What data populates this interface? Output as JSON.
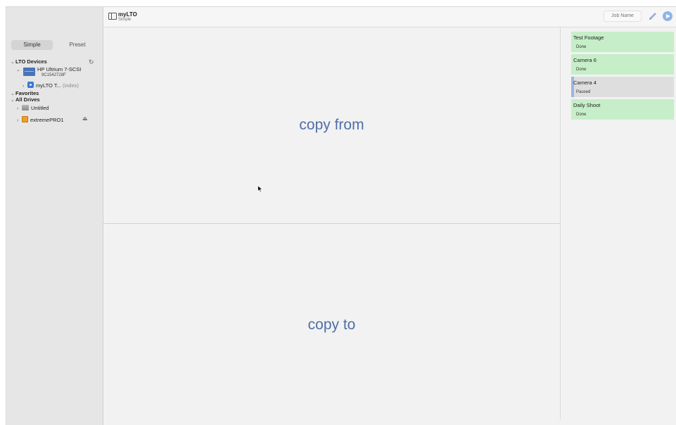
{
  "toolbar": {
    "title": "myLTO",
    "subtitle": "Simple",
    "job_name_placeholder": "Job Name"
  },
  "sidebar": {
    "segments": [
      "Simple",
      "Preset"
    ],
    "selected_segment": "Simple",
    "lto_devices_label": "LTO Devices",
    "device_name": "HP Ultrium 7-SCSI",
    "device_serial": "9C1542728F",
    "tape_name": "myLTO T...",
    "tape_suffix": "(index)",
    "favorites_label": "Favorites",
    "all_drives_label": "All Drives",
    "drives": [
      "Untitled",
      "extremePRO1"
    ]
  },
  "main": {
    "copy_from": "copy from",
    "copy_to": "copy to"
  },
  "jobs": [
    {
      "title": "Test Footage",
      "status": "Done"
    },
    {
      "title": "Camera 6",
      "status": "Done"
    },
    {
      "title": "Camera 4",
      "status": "Paused"
    },
    {
      "title": "Daily Shoot",
      "status": "Done"
    }
  ],
  "colors": {
    "accent": "#4f6ea8",
    "done": "#c6eec8",
    "paused": "#dedede",
    "progress": "#9db3e8"
  }
}
